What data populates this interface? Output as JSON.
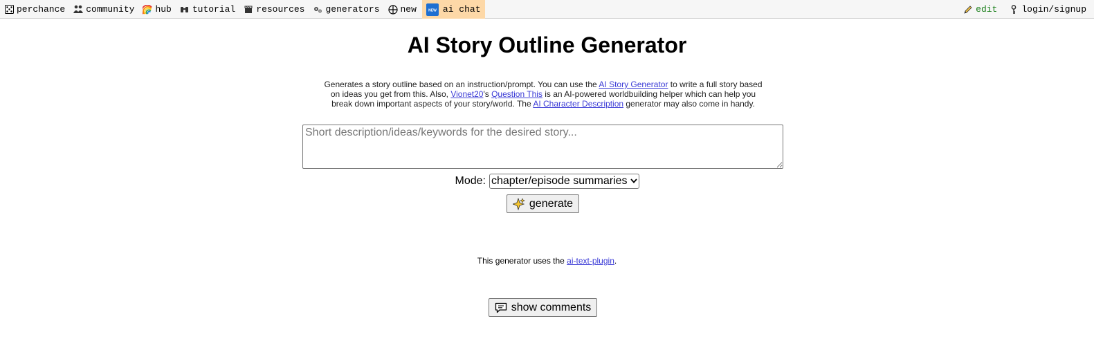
{
  "nav": {
    "left_items": [
      {
        "label": "perchance",
        "icon": "dice-icon"
      },
      {
        "label": "community",
        "icon": "people-icon"
      },
      {
        "label": "hub",
        "icon": "rainbow-icon"
      },
      {
        "label": "tutorial",
        "icon": "binoculars-icon"
      },
      {
        "label": "resources",
        "icon": "clapper-icon"
      },
      {
        "label": "generators",
        "icon": "gears-icon"
      },
      {
        "label": "new",
        "icon": "globe-plus-icon"
      },
      {
        "label": "ai chat",
        "icon": "new-badge-icon",
        "badge_text": "NEW",
        "highlight": "#fdd8a7"
      }
    ],
    "right_items": [
      {
        "label": "edit",
        "icon": "pencil-icon",
        "color": "#1a7f1a"
      },
      {
        "label": "login/signup",
        "icon": "key-icon"
      }
    ]
  },
  "main": {
    "title": "AI Story Outline Generator",
    "description": {
      "t1": "Generates a story outline based on an instruction/prompt. You can use the ",
      "link1": "AI Story Generator",
      "t2": " to write a full story based on ideas you get from this. Also, ",
      "link2": "Vionet20",
      "t3": "'s ",
      "link3": "Question This",
      "t4": " is an AI-powered worldbuilding helper which can help you break down important aspects of your story/world. The ",
      "link4": "AI Character Description",
      "t5": " generator may also come in handy."
    },
    "input": {
      "placeholder": "Short description/ideas/keywords for the desired story...",
      "value": ""
    },
    "mode": {
      "label": "Mode:",
      "selected": "chapter/episode summaries"
    },
    "generate_label": "generate",
    "footer": {
      "text": "This generator uses the ",
      "link": "ai-text-plugin",
      "after": "."
    },
    "comments_label": "show comments"
  },
  "colors": {
    "link": "#3b3bd6",
    "highlight": "#fdd8a7",
    "edit": "#1a7f1a"
  }
}
